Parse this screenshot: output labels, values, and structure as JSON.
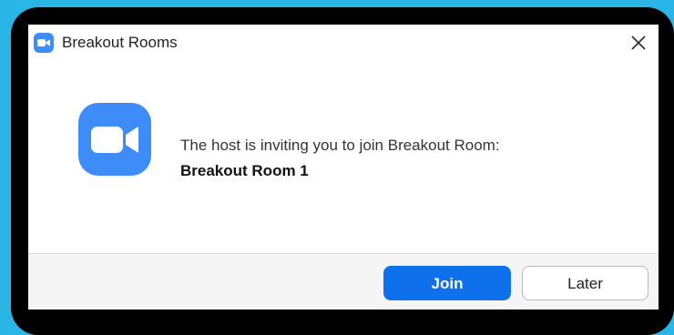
{
  "window": {
    "title": "Breakout Rooms",
    "app_icon": "zoom-camera-icon",
    "close_icon": "close-icon"
  },
  "body": {
    "icon": "zoom-camera-icon",
    "message": "The host is inviting you to join Breakout Room:",
    "room_name": "Breakout Room 1"
  },
  "buttons": {
    "join_label": "Join",
    "later_label": "Later"
  },
  "colors": {
    "background": "#29b6e6",
    "frame": "#000000",
    "brand_blue": "#0e71eb",
    "icon_blue": "#3d8cf7"
  }
}
